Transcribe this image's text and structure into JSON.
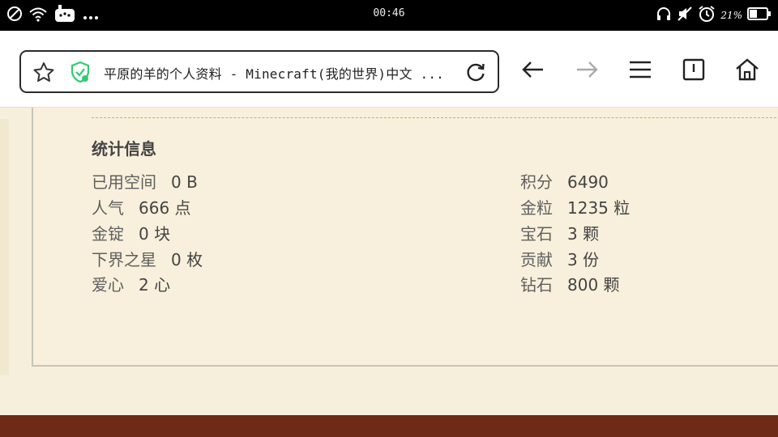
{
  "status_bar": {
    "time": "00:46",
    "battery_percent": "21%",
    "icons_left": [
      "do-not-disturb-icon",
      "wifi-icon",
      "vpn-icon",
      "more-icon"
    ],
    "icons_right": [
      "headphones-icon",
      "mute-icon",
      "alarm-icon",
      "battery-icon"
    ]
  },
  "browser": {
    "url_text": "平原的羊的个人资料 - Minecraft(我的世界)中文 ...",
    "icons": {
      "bookmark": "star-icon",
      "security": "shield-check-icon",
      "reload": "reload-icon",
      "back": "arrow-left-icon",
      "forward": "arrow-right-icon",
      "menu": "hamburger-menu-icon",
      "tabs": "tab-switcher-icon",
      "home": "home-icon"
    },
    "accent_color": "#2ecc71"
  },
  "stats": {
    "heading": "统计信息",
    "left": [
      {
        "label": "已用空间",
        "value": "0 B"
      },
      {
        "label": "人气",
        "value": "666 点"
      },
      {
        "label": "金锭",
        "value": "0 块"
      },
      {
        "label": "下界之星",
        "value": "0 枚"
      },
      {
        "label": "爱心",
        "value": "2 心"
      }
    ],
    "right": [
      {
        "label": "积分",
        "value": "6490"
      },
      {
        "label": "金粒",
        "value": "1235 粒"
      },
      {
        "label": "宝石",
        "value": "3 颗"
      },
      {
        "label": "贡献",
        "value": "3 份"
      },
      {
        "label": "钻石",
        "value": "800 颗"
      }
    ]
  },
  "colors": {
    "page_background": "#f6efdc",
    "footer": "#6f2a17",
    "divider": "#d6a46b"
  }
}
